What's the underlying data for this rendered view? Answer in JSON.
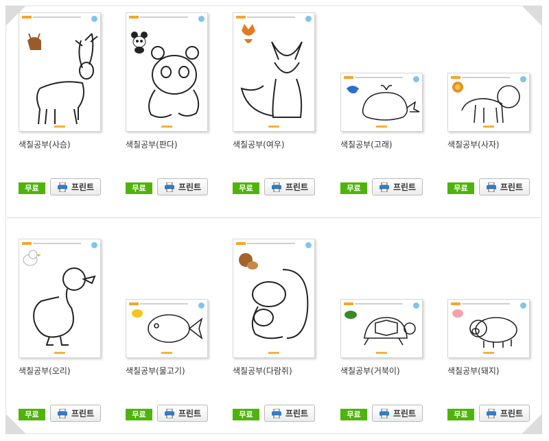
{
  "items": [
    {
      "title": "색칠공부(사슴)",
      "free": "무료",
      "print": "프린트",
      "animal": "deer"
    },
    {
      "title": "색칠공부(판다)",
      "free": "무료",
      "print": "프린트",
      "animal": "panda"
    },
    {
      "title": "색칠공부(여우)",
      "free": "무료",
      "print": "프린트",
      "animal": "fox"
    },
    {
      "title": "색칠공부(고래)",
      "free": "무료",
      "print": "프린트",
      "animal": "whale"
    },
    {
      "title": "색칠공부(사자)",
      "free": "무료",
      "print": "프린트",
      "animal": "lion"
    },
    {
      "title": "색칠공부(오리)",
      "free": "무료",
      "print": "프린트",
      "animal": "duck"
    },
    {
      "title": "색칠공부(물고기)",
      "free": "무료",
      "print": "프린트",
      "animal": "fish"
    },
    {
      "title": "색칠공부(다람쥐)",
      "free": "무료",
      "print": "프린트",
      "animal": "squirrel"
    },
    {
      "title": "색칠공부(거북이)",
      "free": "무료",
      "print": "프린트",
      "animal": "turtle"
    },
    {
      "title": "색칠공부(돼지)",
      "free": "무료",
      "print": "프린트",
      "animal": "pig"
    }
  ],
  "colors": {
    "free_badge": "#4fb40a",
    "print_icon": "#2a7fd4",
    "accent": "#f4a52a"
  }
}
